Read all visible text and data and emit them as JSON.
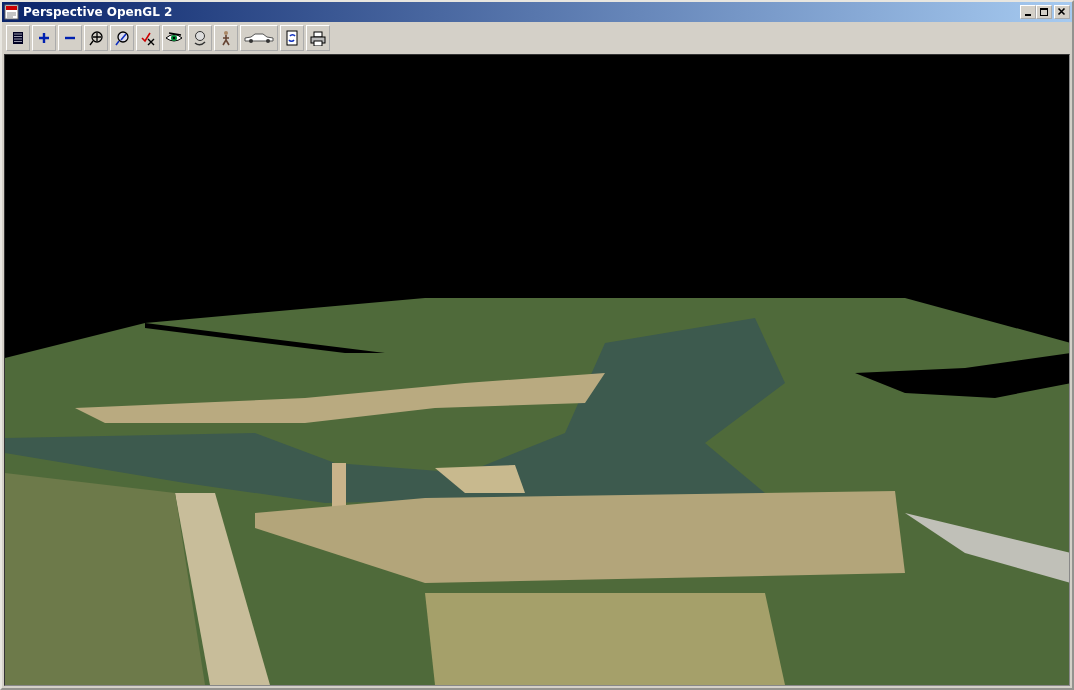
{
  "window": {
    "title": "Perspective OpenGL 2",
    "controls": [
      {
        "kind": "minimize"
      },
      {
        "kind": "maximize"
      },
      {
        "kind": "close"
      }
    ]
  },
  "toolbar": [
    {
      "kind": "list"
    },
    {
      "kind": "plus"
    },
    {
      "kind": "minus"
    },
    {
      "kind": "zoom"
    },
    {
      "kind": "pan"
    },
    {
      "kind": "check"
    },
    {
      "kind": "eye"
    },
    {
      "kind": "rotate"
    },
    {
      "kind": "walk"
    },
    {
      "kind": "car"
    },
    {
      "kind": "refresh"
    },
    {
      "kind": "print"
    }
  ],
  "view": {
    "kind": "terrain"
  }
}
